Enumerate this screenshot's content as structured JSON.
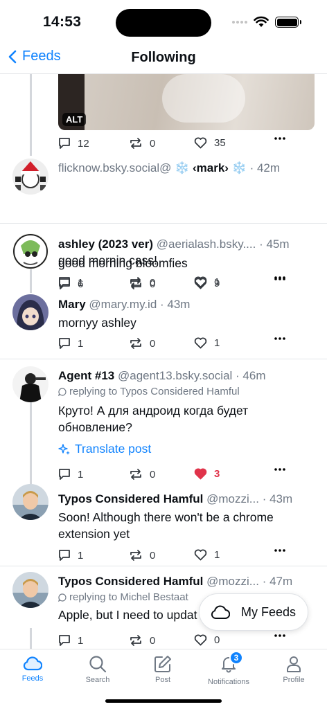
{
  "status": {
    "time": "14:53"
  },
  "nav": {
    "back_label": "Feeds",
    "title": "Following"
  },
  "image_post": {
    "alt_badge": "ALT",
    "replies": "12",
    "reposts": "0",
    "likes": "35"
  },
  "posts": [
    {
      "name": "",
      "handle": "flicknow.bsky.social@",
      "extra": " ❄️ ‹mark› ❄️",
      "time": "· 42m",
      "text": "good mornin cass!",
      "replies": "1",
      "reposts": "0",
      "likes": "1"
    },
    {
      "name": "ashley (2023 ver)",
      "handle": "@aerialash.bsky....",
      "time": "· 45m",
      "text": "good morning bloomfies",
      "replies": "6",
      "reposts": "0",
      "likes": "9"
    },
    {
      "name": "Mary",
      "handle": "@mary.my.id",
      "time": "· 43m",
      "text": "mornyy ashley",
      "replies": "1",
      "reposts": "0",
      "likes": "1"
    },
    {
      "name": "Agent #13",
      "handle": "@agent13.bsky.social",
      "time": "· 46m",
      "reply_to": "replying to Typos Considered Hamful",
      "text": "Круто! А для андроид когда будет обновление?",
      "translate": "Translate post",
      "replies": "1",
      "reposts": "0",
      "likes": "3"
    },
    {
      "name": "Typos Considered Hamful",
      "handle": "@mozzi...",
      "time": "· 43m",
      "text": "Soon! Although there won't be a chrome extension yet",
      "replies": "1",
      "reposts": "0",
      "likes": "1"
    },
    {
      "name": "Typos Considered Hamful",
      "handle": "@mozzi...",
      "time": "· 47m",
      "reply_to": "replying to Michel Bestaat",
      "text": "Apple, but I need to updat",
      "replies": "1",
      "reposts": "0",
      "likes": "0"
    }
  ],
  "fab": {
    "label": "My Feeds"
  },
  "tabs": {
    "feeds": "Feeds",
    "search": "Search",
    "post": "Post",
    "notifications": "Notifications",
    "notifications_badge": "3",
    "profile": "Profile"
  },
  "colors": {
    "accent": "#1083fe",
    "like": "#e0334a",
    "text": "#0b0f14",
    "muted": "#6f7884"
  }
}
